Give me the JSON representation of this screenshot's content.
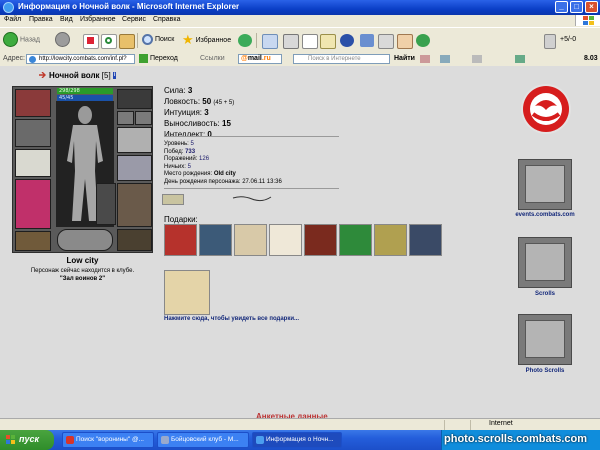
{
  "window": {
    "title": "Информация о Ночной волк - Microsoft Internet Explorer"
  },
  "menu": [
    "Файл",
    "Правка",
    "Вид",
    "Избранное",
    "Сервис",
    "Справка"
  ],
  "toolbar": {
    "back": "Назад",
    "search": "Поиск",
    "favorites": "Избранное",
    "right_counter": "+5/-0"
  },
  "address": {
    "label": "Адрес:",
    "url": "http://lowcity.combats.com/inf.pl?",
    "go": "Переход",
    "links": "Ссылки",
    "mailru_a": "@",
    "mailru_b": "mail",
    "mailru_c": ".ru",
    "search_placeholder": "Поиск в Интернете",
    "find": "Найти",
    "price": "8.03"
  },
  "character": {
    "nick": "Ночной волк",
    "level_badge": "[5]",
    "info_badge": "i",
    "hp": "298/298",
    "mp": "45/45",
    "city": "Low city",
    "location_line": "Персонаж сейчас находится в клубе.",
    "location_room": "\"Зал воинов 2\""
  },
  "stats": [
    {
      "label": "Сила:",
      "value": "3",
      "extra": ""
    },
    {
      "label": "Ловкость:",
      "value": "50",
      "extra": "(45 + 5)"
    },
    {
      "label": "Интуиция:",
      "value": "3",
      "extra": ""
    },
    {
      "label": "Выносливость:",
      "value": "15",
      "extra": ""
    },
    {
      "label": "Интеллект:",
      "value": "0",
      "extra": ""
    }
  ],
  "info": [
    {
      "label": "Уровень:",
      "value": "5"
    },
    {
      "label": "Побед:",
      "value": "733"
    },
    {
      "label": "Поражений:",
      "value": "126"
    },
    {
      "label": "Ничьих:",
      "value": "5"
    },
    {
      "label": "Место рождения:",
      "value": "Old city"
    },
    {
      "label": "День рождения персонажа:",
      "value": "27.06.11 13:36"
    }
  ],
  "gifts": {
    "label": "Подарки:",
    "colors": [
      "#b6322c",
      "#3c5a78",
      "#d8c9a8",
      "#efe8d8",
      "#7a2a1e",
      "#2e8a3a",
      "#b0a050",
      "#3a4a66"
    ],
    "link": "Нажмите сюда, чтобы увидеть все подарки..."
  },
  "page_bottom": "Анкетные данные",
  "side": {
    "events": "events.combats.com",
    "scrolls": "Scrolls",
    "photo_scrolls": "Photo Scrolls",
    "banner_text_1": "events",
    "banner_text_3": "photo"
  },
  "statusbar": {
    "zone": "Internet"
  },
  "taskbar": {
    "start": "пуск",
    "tasks": [
      "Поиск \"воронины\" @...",
      "Бойцовский клуб - М...",
      "Информация о Ночн..."
    ],
    "watermark": "photo.scrolls.combats.com"
  }
}
